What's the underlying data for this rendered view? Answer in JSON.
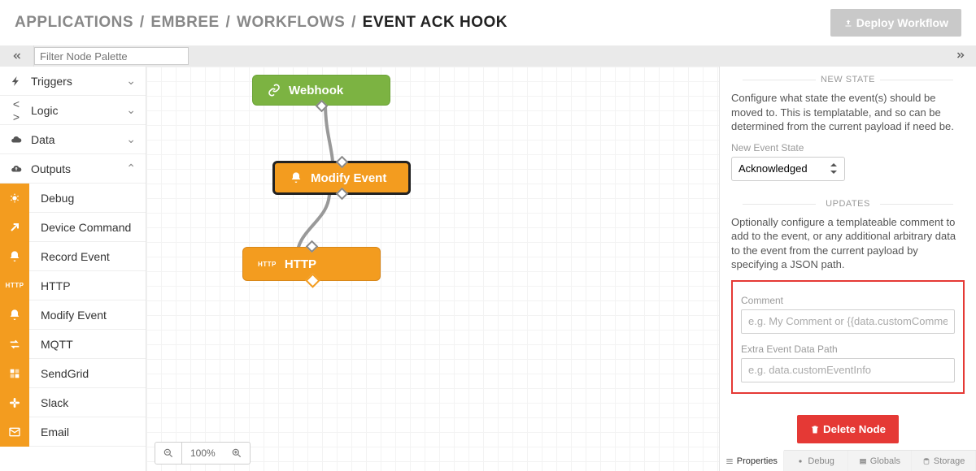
{
  "breadcrumb": {
    "parts": [
      "APPLICATIONS",
      "EMBREE",
      "WORKFLOWS"
    ],
    "current": "EVENT ACK HOOK"
  },
  "header": {
    "deploy_label": "Deploy Workflow"
  },
  "palette": {
    "filter_placeholder": "Filter Node Palette",
    "categories": {
      "triggers": "Triggers",
      "logic": "Logic",
      "data": "Data",
      "outputs": "Outputs"
    },
    "output_items": [
      {
        "id": "debug",
        "label": "Debug",
        "icon": "bug"
      },
      {
        "id": "device_command",
        "label": "Device Command",
        "icon": "arrow-up-right"
      },
      {
        "id": "record_event",
        "label": "Record Event",
        "icon": "bell"
      },
      {
        "id": "http",
        "label": "HTTP",
        "icon": "http"
      },
      {
        "id": "modify_event",
        "label": "Modify Event",
        "icon": "bell"
      },
      {
        "id": "mqtt",
        "label": "MQTT",
        "icon": "swap"
      },
      {
        "id": "sendgrid",
        "label": "SendGrid",
        "icon": "sendgrid"
      },
      {
        "id": "slack",
        "label": "Slack",
        "icon": "slack"
      },
      {
        "id": "email",
        "label": "Email",
        "icon": "mail"
      }
    ]
  },
  "canvas": {
    "zoom": "100%",
    "nodes": {
      "webhook": "Webhook",
      "modify_event": "Modify Event",
      "http": "HTTP"
    }
  },
  "rightpanel": {
    "sections": {
      "new_state": "NEW STATE",
      "updates": "UPDATES"
    },
    "new_state_desc": "Configure what state the event(s) should be moved to. This is templatable, and so can be determined from the current payload if need be.",
    "new_state_label": "New Event State",
    "new_state_value": "Acknowledged",
    "updates_desc": "Optionally configure a templateable comment to add to the event, or any additional arbitrary data to the event from the current payload by specifying a JSON path.",
    "comment_label": "Comment",
    "comment_placeholder": "e.g. My Comment or {{data.customComment}}",
    "extra_path_label": "Extra Event Data Path",
    "extra_path_placeholder": "e.g. data.customEventInfo",
    "delete_label": "Delete Node",
    "tabs": {
      "properties": "Properties",
      "debug": "Debug",
      "globals": "Globals",
      "storage": "Storage"
    }
  }
}
